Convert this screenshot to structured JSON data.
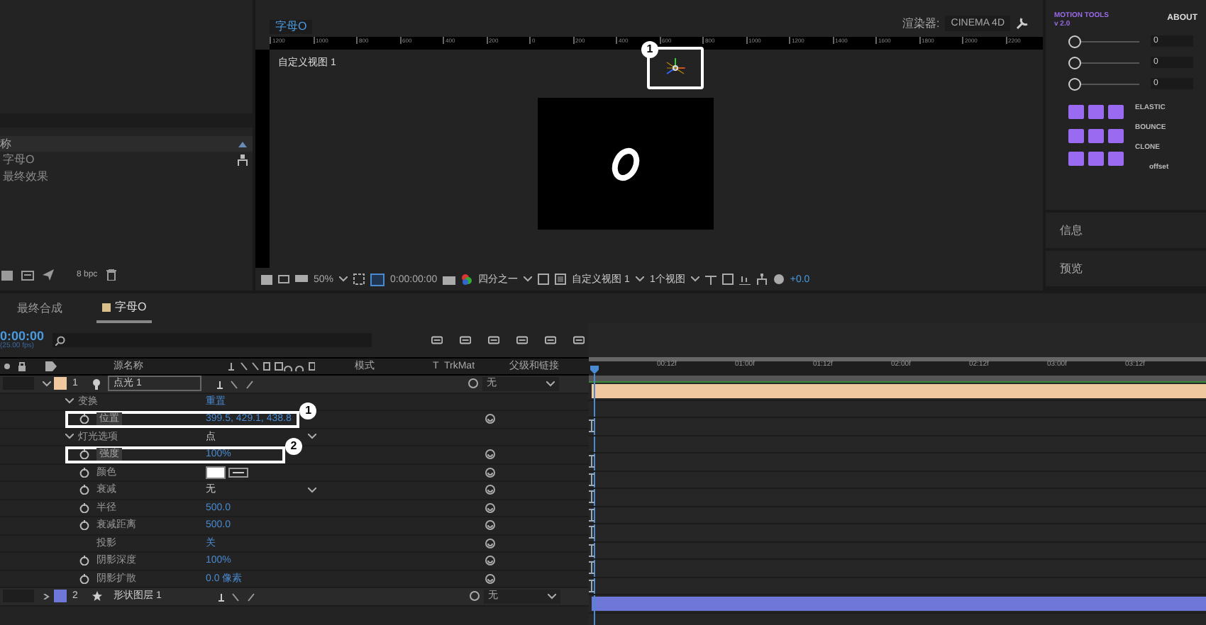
{
  "project_panel": {
    "header": "称",
    "items": [
      {
        "name": "字母O"
      },
      {
        "name": "最终效果"
      }
    ],
    "bit_depth": "8 bpc"
  },
  "viewer": {
    "tab": "字母O",
    "renderer_label": "渲染器:",
    "renderer": "CINEMA 4D",
    "view_name": "自定义视图 1",
    "callout": "1",
    "ruler": [
      "1200",
      "1000",
      "800",
      "600",
      "400",
      "200",
      "0",
      "200",
      "400",
      "600",
      "800",
      "1000",
      "1200",
      "1400",
      "1600",
      "1800",
      "2000",
      "2200"
    ],
    "toolbar": {
      "zoom": "50%",
      "timecode": "0:00:00:00",
      "resolution": "四分之一",
      "view": "自定义视图 1",
      "layout": "1个视图",
      "exposure": "+0.0"
    }
  },
  "motion_tools": {
    "title": "MOTION TOOLS v 2.0",
    "about": "ABOUT",
    "sliders": [
      {
        "value": "0",
        "level": 0
      },
      {
        "value": "0",
        "level": 0
      },
      {
        "value": "0",
        "level": 0
      }
    ],
    "options": [
      "ELASTIC",
      "BOUNCE",
      "CLONE"
    ],
    "footer": "offset"
  },
  "side_panels": [
    "信息",
    "预览"
  ],
  "timeline": {
    "tabs": [
      {
        "label": "最终合成",
        "selected": false
      },
      {
        "label": "字母O",
        "selected": true
      }
    ],
    "timecode": "0:00:00",
    "fps": "(25.00 fps)",
    "columns": [
      "源名称",
      "模式",
      "T",
      "TrkMat",
      "父级和链接"
    ],
    "time_ticks": [
      "00:12f",
      "01:00f",
      "01:12f",
      "02:00f",
      "02:12f",
      "03:00f",
      "03:12f"
    ],
    "layers": [
      {
        "number": "1",
        "name": "点光 1",
        "color": "#f0c8a0",
        "parent": "无",
        "expanded": true,
        "children": [
          {
            "name": "变换",
            "value": "重置",
            "kind": "link",
            "expanded": true,
            "children": [
              {
                "name": "位置",
                "value": "399.5, 429.1, 438.8",
                "kind": "number",
                "stopwatch": true,
                "callout": "1"
              }
            ]
          },
          {
            "name": "灯光选项",
            "value": "点",
            "kind": "dropdown",
            "expanded": true,
            "children": [
              {
                "name": "强度",
                "value": "100%",
                "kind": "number",
                "stopwatch": true,
                "callout": "2"
              },
              {
                "name": "颜色",
                "kind": "color",
                "color": "#ffffff",
                "stopwatch": true
              },
              {
                "name": "衰减",
                "value": "无",
                "kind": "dropdown",
                "stopwatch": true
              },
              {
                "name": "半径",
                "value": "500.0",
                "kind": "number",
                "stopwatch": true
              },
              {
                "name": "衰减距离",
                "value": "500.0",
                "kind": "number",
                "stopwatch": true
              },
              {
                "name": "投影",
                "value": "关",
                "kind": "number",
                "stopwatch": false
              },
              {
                "name": "阴影深度",
                "value": "100%",
                "kind": "number",
                "stopwatch": true
              },
              {
                "name": "阴影扩散",
                "value": "0.0 像素",
                "kind": "number",
                "stopwatch": true
              }
            ]
          }
        ]
      },
      {
        "number": "2",
        "name": "形状图层 1",
        "color": "#6f78d8",
        "parent": "无",
        "expanded": false
      }
    ]
  }
}
